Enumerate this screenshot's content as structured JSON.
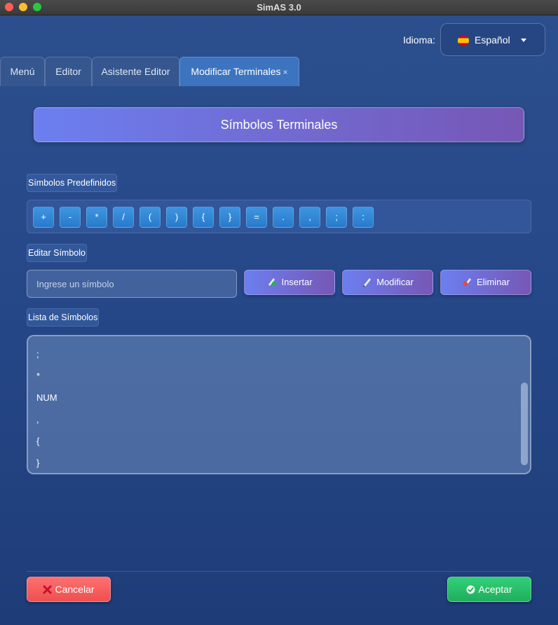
{
  "window": {
    "title": "SimAS 3.0"
  },
  "language": {
    "label": "Idioma:",
    "value": "Español"
  },
  "tabs": [
    {
      "label": "Menú"
    },
    {
      "label": "Editor"
    },
    {
      "label": "Asistente Editor"
    },
    {
      "label": "Modificar Terminales",
      "close": "×"
    }
  ],
  "header": {
    "title": "Símbolos Terminales"
  },
  "predefined": {
    "label": "Símbolos Predefinidos",
    "symbols": [
      "+",
      "-",
      "*",
      "/",
      "(",
      ")",
      "{",
      "}",
      "=",
      ".",
      ",",
      ";",
      ":"
    ]
  },
  "edit": {
    "label": "Editar Símbolo",
    "placeholder": "Ingrese un símbolo",
    "insert": "Insertar",
    "modify": "Modificar",
    "delete": "Eliminar"
  },
  "list": {
    "label": "Lista de Símbolos",
    "items": [
      ";",
      "*",
      "NUM",
      ",",
      "{",
      "}"
    ]
  },
  "footer": {
    "cancel": "Cancelar",
    "accept": "Aceptar"
  }
}
